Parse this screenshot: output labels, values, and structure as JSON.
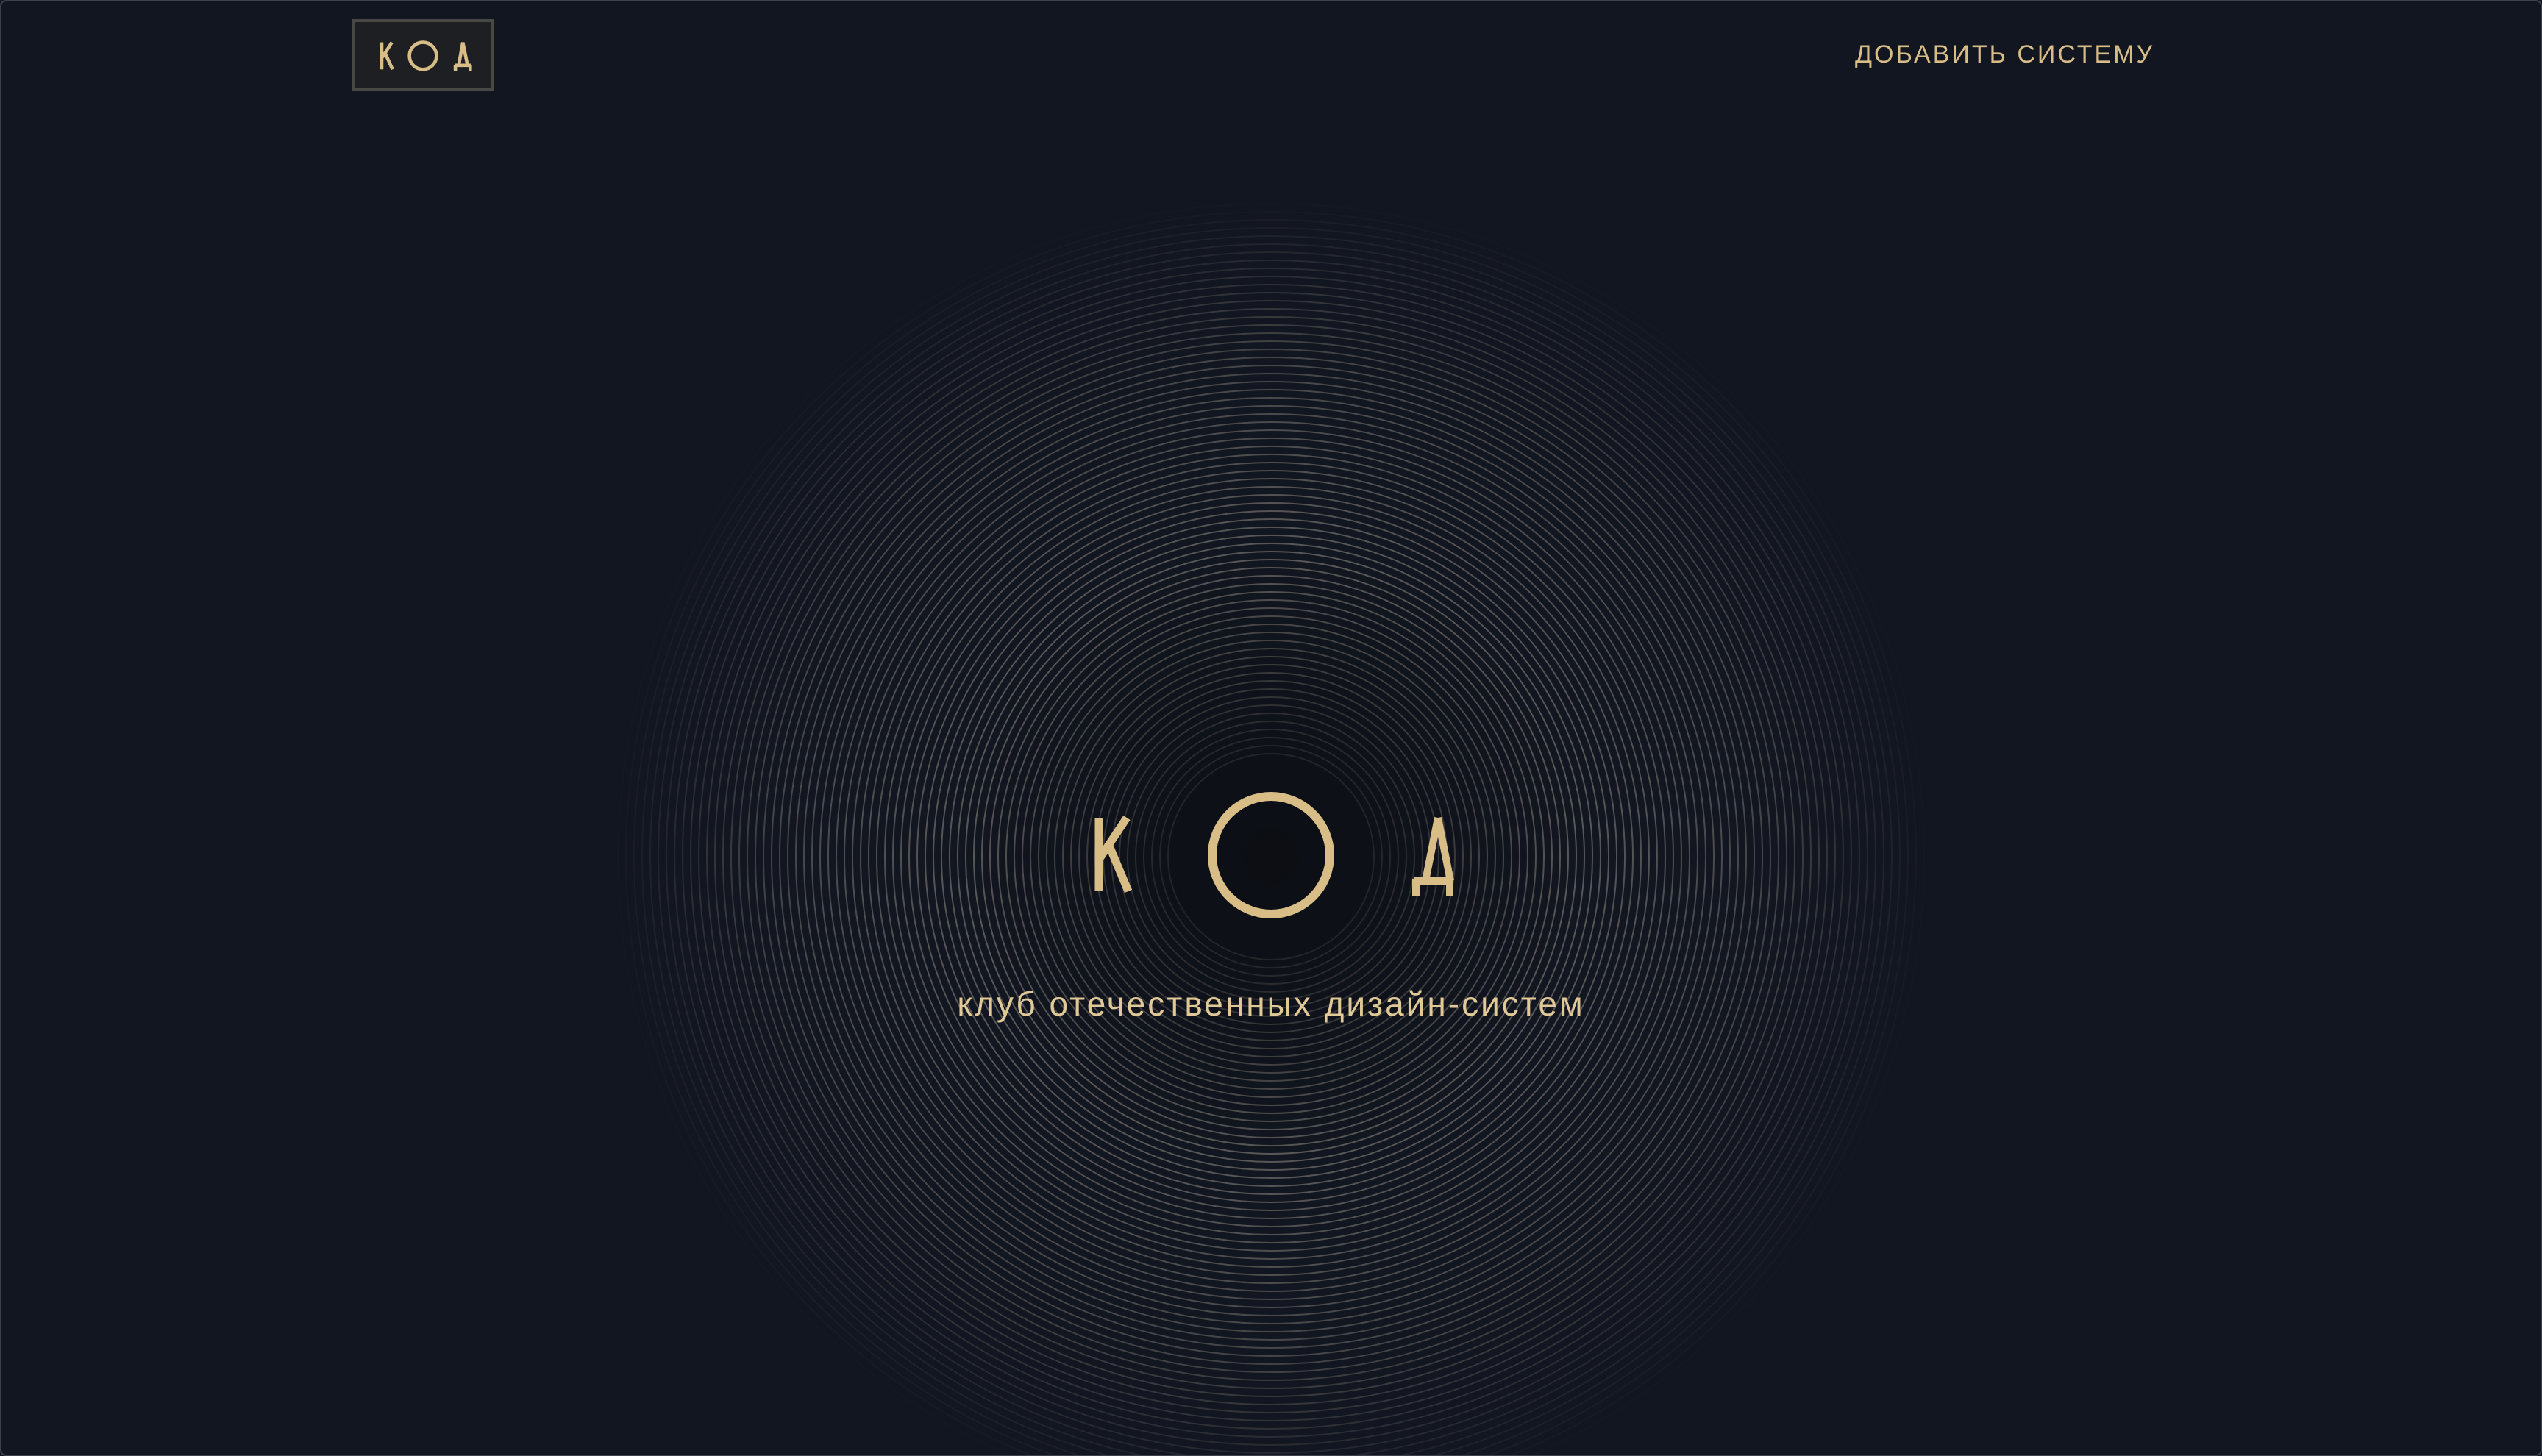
{
  "header": {
    "logo_letters": [
      "К",
      "О",
      "Д"
    ],
    "logo_icon": "kod-logo-icon",
    "nav_link_label": "ДОБАВИТЬ СИСТЕМУ"
  },
  "hero": {
    "logo_letters": [
      "К",
      "О",
      "Д"
    ],
    "logo_icon": "kod-wordmark-icon",
    "tagline": "клуб отечественных дизайн-систем",
    "background_icon": "concentric-rings-icon"
  },
  "colors": {
    "background": "#121620",
    "accent": "#d9bd87",
    "ring": "#bfb7a8"
  }
}
